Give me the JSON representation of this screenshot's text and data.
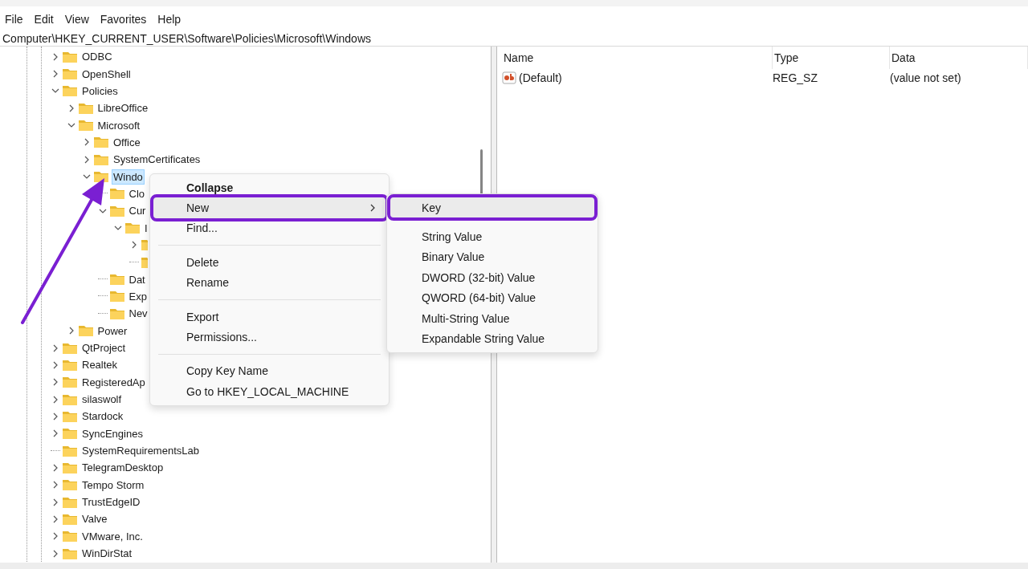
{
  "menu_bar": [
    "File",
    "Edit",
    "View",
    "Favorites",
    "Help"
  ],
  "address": "Computer\\HKEY_CURRENT_USER\\Software\\Policies\\Microsoft\\Windows",
  "tree": [
    {
      "name": "ODBC",
      "kind": "branch",
      "expanded": false,
      "selected": false
    },
    {
      "name": "OpenShell",
      "kind": "branch",
      "expanded": false,
      "selected": false
    },
    {
      "name": "Policies",
      "kind": "branch",
      "expanded": true,
      "selected": false,
      "children": [
        {
          "name": "LibreOffice",
          "kind": "branch",
          "expanded": false,
          "selected": false
        },
        {
          "name": "Microsoft",
          "kind": "branch",
          "expanded": true,
          "selected": false,
          "children": [
            {
              "name": "Office",
              "kind": "branch",
              "expanded": false,
              "selected": false
            },
            {
              "name": "SystemCertificates",
              "kind": "branch",
              "expanded": false,
              "selected": false
            },
            {
              "name": "Windo",
              "kind": "branch",
              "expanded": true,
              "selected": true,
              "children": [
                {
                  "name": "Clo",
                  "kind": "leaf",
                  "selected": false
                },
                {
                  "name": "Cur",
                  "kind": "branch",
                  "expanded": true,
                  "selected": false,
                  "children": [
                    {
                      "name": "I",
                      "kind": "branch",
                      "expanded": true,
                      "selected": false,
                      "children": [
                        {
                          "kind": "branch",
                          "expanded": false
                        },
                        {
                          "kind": "leaf"
                        }
                      ]
                    }
                  ]
                },
                {
                  "name": "Dat",
                  "kind": "leaf",
                  "selected": false
                },
                {
                  "name": "Exp",
                  "kind": "leaf",
                  "selected": false
                },
                {
                  "name": "Nev",
                  "kind": "leaf",
                  "selected": false
                }
              ]
            }
          ]
        },
        {
          "name": "Power",
          "kind": "branch",
          "expanded": false,
          "selected": false
        }
      ]
    },
    {
      "name": "QtProject",
      "kind": "branch",
      "expanded": false,
      "selected": false
    },
    {
      "name": "Realtek",
      "kind": "branch",
      "expanded": false,
      "selected": false
    },
    {
      "name": "RegisteredAp",
      "kind": "branch",
      "expanded": false,
      "selected": false
    },
    {
      "name": "silaswolf",
      "kind": "branch",
      "expanded": false,
      "selected": false
    },
    {
      "name": "Stardock",
      "kind": "branch",
      "expanded": false,
      "selected": false
    },
    {
      "name": "SyncEngines",
      "kind": "branch",
      "expanded": false,
      "selected": false
    },
    {
      "name": "SystemRequirementsLab",
      "kind": "leaf",
      "selected": false
    },
    {
      "name": "TelegramDesktop",
      "kind": "branch",
      "expanded": false,
      "selected": false
    },
    {
      "name": "Tempo Storm",
      "kind": "branch",
      "expanded": false,
      "selected": false
    },
    {
      "name": "TrustEdgeID",
      "kind": "branch",
      "expanded": false,
      "selected": false
    },
    {
      "name": "Valve",
      "kind": "branch",
      "expanded": false,
      "selected": false
    },
    {
      "name": "VMware, Inc.",
      "kind": "branch",
      "expanded": false,
      "selected": false
    },
    {
      "name": "WinDirStat",
      "kind": "branch",
      "expanded": false,
      "selected": false
    }
  ],
  "values": {
    "columns": [
      "Name",
      "Type",
      "Data"
    ],
    "rows": [
      {
        "name": "(Default)",
        "type": "REG_SZ",
        "data": "(value not set)"
      }
    ]
  },
  "context_menu": [
    {
      "kind": "item",
      "label": "Collapse",
      "default": true,
      "selected": false,
      "outlined": false
    },
    {
      "kind": "item",
      "label": "New",
      "submenu": true,
      "selected": true,
      "outlined": true
    },
    {
      "kind": "item",
      "label": "Find...",
      "selected": false,
      "outlined": false
    },
    {
      "kind": "separator"
    },
    {
      "kind": "item",
      "label": "Delete",
      "selected": false,
      "outlined": false
    },
    {
      "kind": "item",
      "label": "Rename",
      "selected": false,
      "outlined": false
    },
    {
      "kind": "separator"
    },
    {
      "kind": "item",
      "label": "Export",
      "selected": false,
      "outlined": false
    },
    {
      "kind": "item",
      "label": "Permissions...",
      "selected": false,
      "outlined": false
    },
    {
      "kind": "separator"
    },
    {
      "kind": "item",
      "label": "Copy Key Name",
      "selected": false,
      "outlined": false
    },
    {
      "kind": "item",
      "label": "Go to HKEY_LOCAL_MACHINE",
      "selected": false,
      "outlined": false
    }
  ],
  "submenu": [
    {
      "kind": "item",
      "label": "Key",
      "selected": true,
      "outlined": true
    },
    {
      "kind": "separator"
    },
    {
      "kind": "item",
      "label": "String Value",
      "selected": false,
      "outlined": false
    },
    {
      "kind": "item",
      "label": "Binary Value",
      "selected": false,
      "outlined": false
    },
    {
      "kind": "item",
      "label": "DWORD (32-bit) Value",
      "selected": false,
      "outlined": false
    },
    {
      "kind": "item",
      "label": "QWORD (64-bit) Value",
      "selected": false,
      "outlined": false
    },
    {
      "kind": "item",
      "label": "Multi-String Value",
      "selected": false,
      "outlined": false
    },
    {
      "kind": "item",
      "label": "Expandable String Value",
      "selected": false,
      "outlined": false
    }
  ]
}
